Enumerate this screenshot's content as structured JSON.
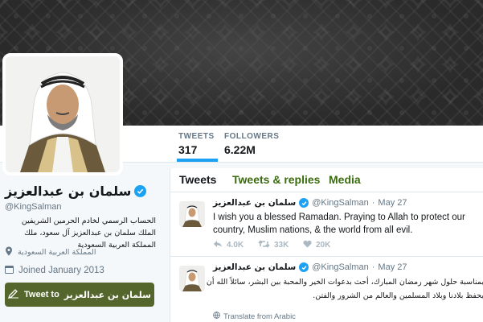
{
  "stats": {
    "tweets_label": "TWEETS",
    "tweets_value": "317",
    "followers_label": "FOLLOWERS",
    "followers_value": "6.22M"
  },
  "profile": {
    "name": "سلمان بن عبدالعزيز",
    "handle": "@KingSalman",
    "bio": "الحساب الرسمي لخادم الحرمين الشريفين الملك سلمان بن عبدالعزيز آل سعود، ملك المملكة العربية السعودية",
    "location": "المملكة العربية السعودية",
    "joined": "Joined January 2013",
    "tweet_to_label": "Tweet to",
    "tweet_to_name": "سلمان بن عبدالعزيز"
  },
  "tabs": {
    "tweets": "Tweets",
    "tweets_replies": "Tweets & replies",
    "media": "Media"
  },
  "tweets": [
    {
      "name": "سلمان بن عبدالعزيز",
      "handle": "@KingSalman",
      "separator": "·",
      "date": "May 27",
      "text": "I wish you a blessed Ramadan. Praying to Allah to protect our country, Muslim nations, & the world from all evil.",
      "replies": "4.0K",
      "retweets": "33K",
      "likes": "20K"
    },
    {
      "name": "سلمان بن عبدالعزيز",
      "handle": "@KingSalman",
      "separator": "·",
      "date": "May 27",
      "text": "بمناسبة حلول شهر رمضان المبارك، أحث بدعوات الخير والمحبة بين البشر، سائلاً الله أن يحفظ بلادنا وبلاد المسلمين والعالم من الشرور والفتن.",
      "translate": "Translate from Arabic"
    }
  ],
  "colors": {
    "accent": "#1da1f2",
    "theme": "#3b6b0f",
    "button": "#55662c"
  }
}
